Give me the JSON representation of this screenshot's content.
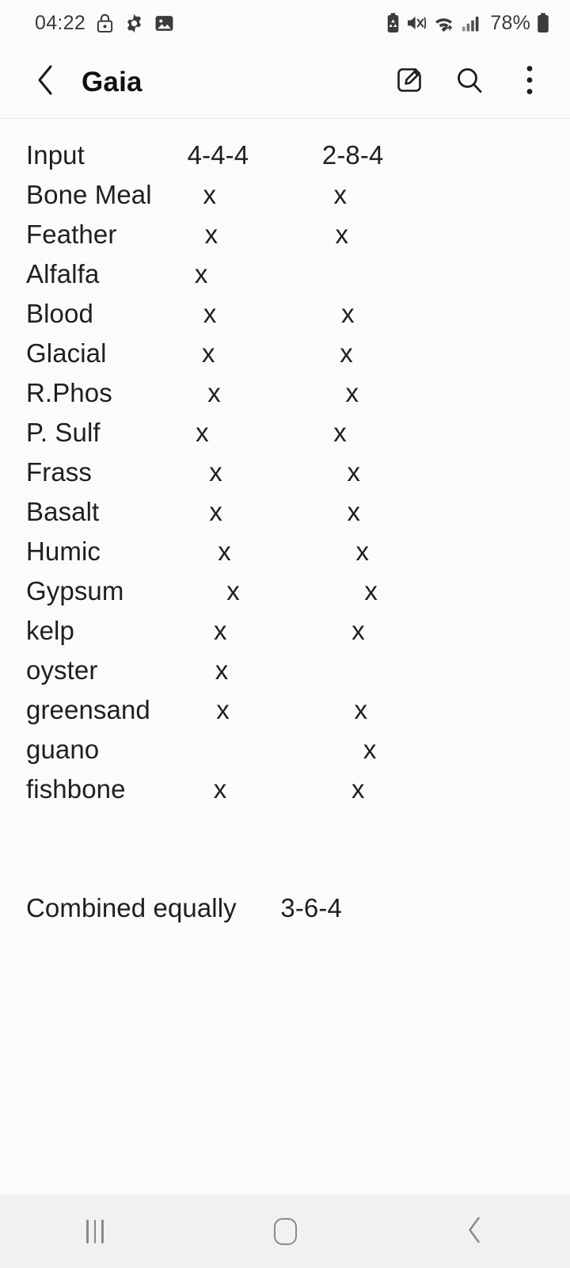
{
  "status_bar": {
    "clock": "04:22",
    "left_icons": [
      "lock-icon",
      "gear-icon",
      "image-icon"
    ],
    "right_icons": [
      "battery-saver-icon",
      "mute-icon",
      "wifi-icon",
      "cellular-signal-icon"
    ],
    "battery_percent": "78%"
  },
  "app_bar": {
    "title": "Gaia",
    "back_icon": "chevron-left-icon",
    "actions": [
      {
        "name": "edit-note-button",
        "icon": "edit-pencil-icon"
      },
      {
        "name": "search-button",
        "icon": "search-icon"
      },
      {
        "name": "more-options-button",
        "icon": "overflow-menu-icon"
      }
    ]
  },
  "note": {
    "columns": [
      "Input",
      "4-4-4",
      "2-8-4"
    ],
    "rows": [
      {
        "input": "Bone Meal",
        "c1": "x",
        "c2": "x"
      },
      {
        "input": "Feather",
        "c1": "x",
        "c2": "x"
      },
      {
        "input": "Alfalfa",
        "c1": "x",
        "c2": ""
      },
      {
        "input": "Blood",
        "c1": "x",
        "c2": "x"
      },
      {
        "input": "Glacial",
        "c1": "x",
        "c2": "x"
      },
      {
        "input": "R.Phos",
        "c1": "x",
        "c2": "x"
      },
      {
        "input": "P. Sulf",
        "c1": "x",
        "c2": "x"
      },
      {
        "input": "Frass",
        "c1": "x",
        "c2": "x"
      },
      {
        "input": "Basalt",
        "c1": "x",
        "c2": "x"
      },
      {
        "input": "Humic",
        "c1": "x",
        "c2": "x"
      },
      {
        "input": "Gypsum",
        "c1": "x",
        "c2": "x"
      },
      {
        "input": "kelp",
        "c1": "x",
        "c2": "x"
      },
      {
        "input": "oyster",
        "c1": "x",
        "c2": ""
      },
      {
        "input": "greensand",
        "c1": "x",
        "c2": "x"
      },
      {
        "input": "guano",
        "c1": "",
        "c2": "x"
      },
      {
        "input": "fishbone",
        "c1": "x",
        "c2": "x"
      }
    ],
    "summary_label": "Combined equally",
    "summary_value": "3-6-4",
    "raw_text": "Input              4-4-4          2-8-4\nBone Meal       x                x\nFeather            x                x\nAlfalfa             x\nBlood               x                 x\nGlacial             x                 x\nR.Phos             x                 x\nP. Sulf             x                 x\nFrass                x                 x\nBasalt               x                 x\nHumic                x                 x\nGypsum              x                 x\nkelp                   x                 x\noyster                x\ngreensand         x                 x\nguano                                    x\nfishbone            x                 x\n\n\nCombined equally      3-6-4"
  },
  "nav_bar": {
    "buttons": [
      {
        "name": "recents-button",
        "icon": "recents-icon"
      },
      {
        "name": "home-button",
        "icon": "home-icon"
      },
      {
        "name": "back-button",
        "icon": "chevron-left-icon"
      }
    ]
  },
  "colors": {
    "background": "#fbfbfb",
    "text": "#1f1f1f",
    "nav_bar": "#f1f1f1",
    "nav_icon": "#8a8a8a",
    "divider": "#ececed"
  }
}
